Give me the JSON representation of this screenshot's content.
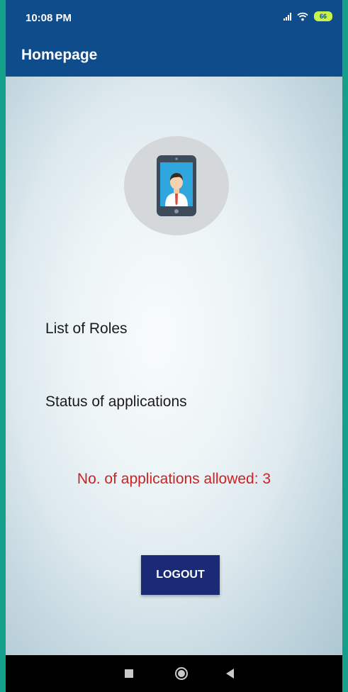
{
  "status_bar": {
    "time": "10:08 PM",
    "battery": "66"
  },
  "app_bar": {
    "title": "Homepage"
  },
  "profile": {
    "icon": "mobile-user-icon"
  },
  "menu": {
    "roles_label": "List of Roles",
    "status_label": "Status of applications"
  },
  "info": {
    "allowed_text": "No. of applications allowed: 3"
  },
  "actions": {
    "logout_label": "LOGOUT"
  },
  "nav": {
    "items": [
      "recent-apps-icon",
      "home-icon",
      "back-icon"
    ]
  },
  "colors": {
    "primary": "#0f4c8c",
    "button": "#1b2a76",
    "alert_text": "#cc2222"
  }
}
